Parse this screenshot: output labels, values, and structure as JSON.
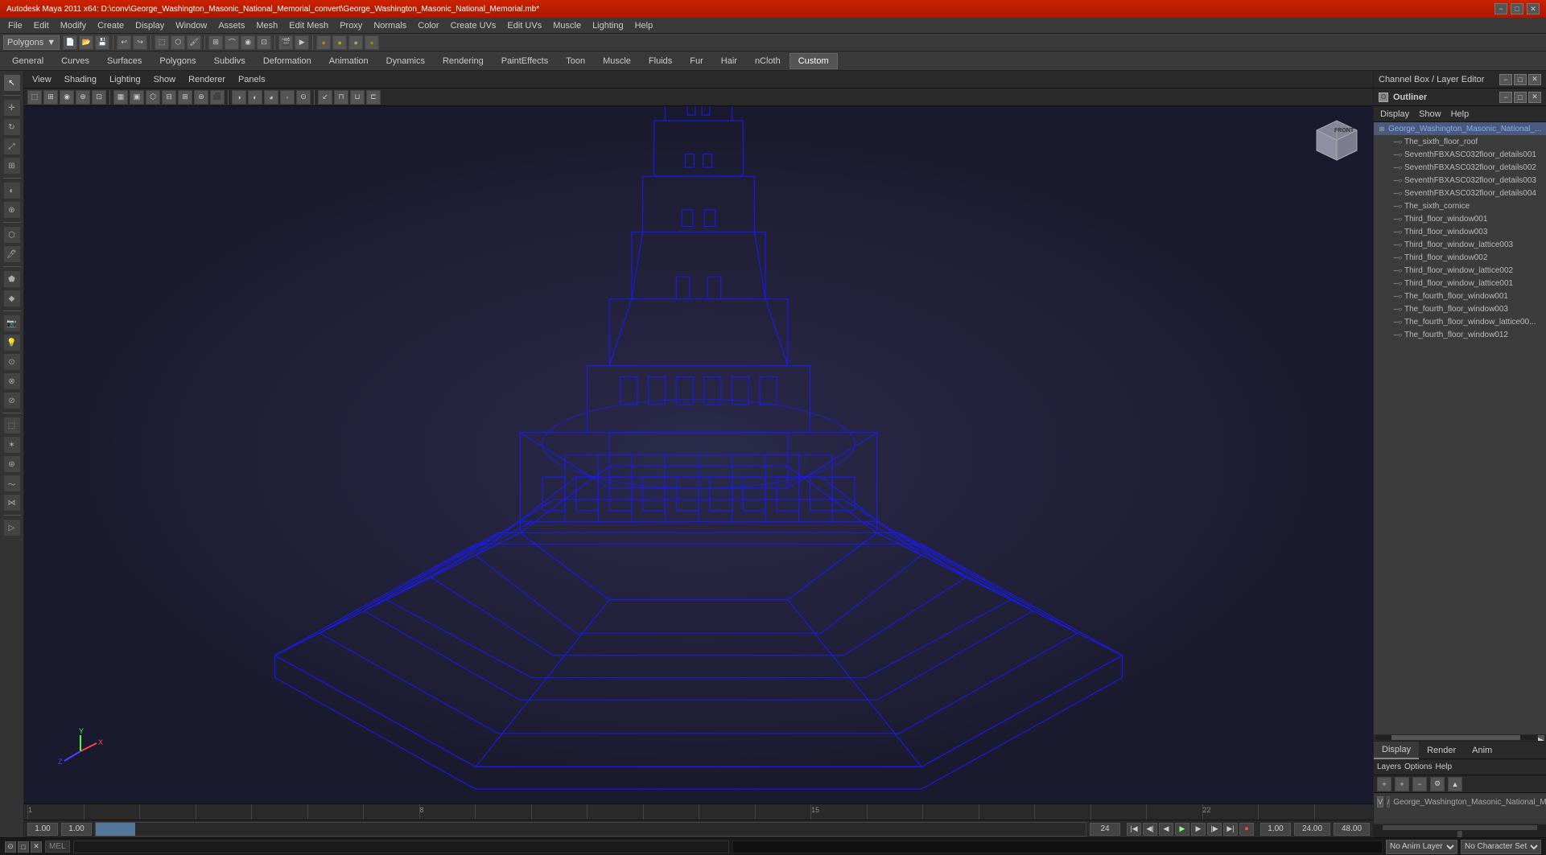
{
  "titlebar": {
    "title": "Autodesk Maya 2011 x64: D:\\conv\\George_Washington_Masonic_National_Memorial_convert\\George_Washington_Masonic_National_Memorial.mb*",
    "min": "−",
    "max": "□",
    "close": "✕"
  },
  "menubar": {
    "items": [
      "File",
      "Edit",
      "Modify",
      "Create",
      "Display",
      "Window",
      "Assets",
      "Mesh",
      "Edit Mesh",
      "Proxy",
      "Normals",
      "Color",
      "Create UVs",
      "Edit UVs",
      "Muscle",
      "Lighting",
      "Help"
    ]
  },
  "modeSelector": {
    "label": "Polygons",
    "arrow": "▼"
  },
  "mainTabs": {
    "items": [
      "General",
      "Curves",
      "Surfaces",
      "Polygons",
      "Subdivs",
      "Deformation",
      "Animation",
      "Dynamics",
      "Rendering",
      "PaintEffects",
      "Toon",
      "Muscle",
      "Fluids",
      "Fur",
      "Hair",
      "nCloth",
      "Custom"
    ]
  },
  "activeTab": "Custom",
  "viewportMenus": [
    "View",
    "Shading",
    "Lighting",
    "Show",
    "Renderer",
    "Panels"
  ],
  "outliner": {
    "title": "Outliner",
    "menus": [
      "Display",
      "Show",
      "Help"
    ],
    "items": [
      {
        "name": "George_Washington_Masonic_National_...",
        "depth": 0,
        "selected": true
      },
      {
        "name": "The_sixth_floor_roof",
        "depth": 1,
        "selected": false
      },
      {
        "name": "SeventhFBXASC032floor_details001",
        "depth": 1,
        "selected": false
      },
      {
        "name": "SeventhFBXASC032floor_details002",
        "depth": 1,
        "selected": false
      },
      {
        "name": "SeventhFBXASC032floor_details003",
        "depth": 1,
        "selected": false
      },
      {
        "name": "SeventhFBXASC032floor_details004",
        "depth": 1,
        "selected": false
      },
      {
        "name": "The_sixth_cornice",
        "depth": 1,
        "selected": false
      },
      {
        "name": "Third_floor_window001",
        "depth": 1,
        "selected": false
      },
      {
        "name": "Third_floor_window003",
        "depth": 1,
        "selected": false
      },
      {
        "name": "Third_floor_window_lattice003",
        "depth": 1,
        "selected": false
      },
      {
        "name": "Third_floor_window002",
        "depth": 1,
        "selected": false
      },
      {
        "name": "Third_floor_window_lattice002",
        "depth": 1,
        "selected": false
      },
      {
        "name": "Third_floor_window_lattice001",
        "depth": 1,
        "selected": false
      },
      {
        "name": "The_fourth_floor_window001",
        "depth": 1,
        "selected": false
      },
      {
        "name": "The_fourth_floor_window003",
        "depth": 1,
        "selected": false
      },
      {
        "name": "The_fourth_floor_window_lattice00...",
        "depth": 1,
        "selected": false
      },
      {
        "name": "The_fourth_floor_window012",
        "depth": 1,
        "selected": false
      }
    ]
  },
  "channelBox": {
    "title": "Channel Box / Layer Editor"
  },
  "bottomPanel": {
    "tabs": [
      "Display",
      "Render",
      "Anim"
    ],
    "activeTab": "Display",
    "subTabs": [
      "Layers",
      "Options",
      "Help"
    ]
  },
  "layerEditor": {
    "layerName": "George_Washington_Masonic_National_Mer",
    "v": "V"
  },
  "timeline": {
    "ticks": [
      "1",
      "",
      "",
      "",
      "",
      "",
      "",
      "8",
      "",
      "",
      "",
      "",
      "",
      "",
      "15",
      "",
      "",
      "",
      "",
      "",
      "",
      "22",
      "",
      "",
      "1"
    ],
    "start": "1.00",
    "end": "1.00",
    "currentFrame": "1",
    "endAnim": "24",
    "endRange": "24.00",
    "farEnd": "48.00",
    "fps": "1.00"
  },
  "animControls": {
    "buttons": [
      "⏮",
      "⏪",
      "◀",
      "▶",
      "⏩",
      "⏭",
      "⏺"
    ]
  },
  "statusBar": {
    "mel": "MEL",
    "placeholder": "",
    "noAnimLayer": "No Anim Layer",
    "characterSet": "No Character Set"
  },
  "navCube": {
    "frontLabel": "FRONT"
  },
  "axis": {
    "x": "X",
    "y": "Y",
    "z": "Z"
  }
}
